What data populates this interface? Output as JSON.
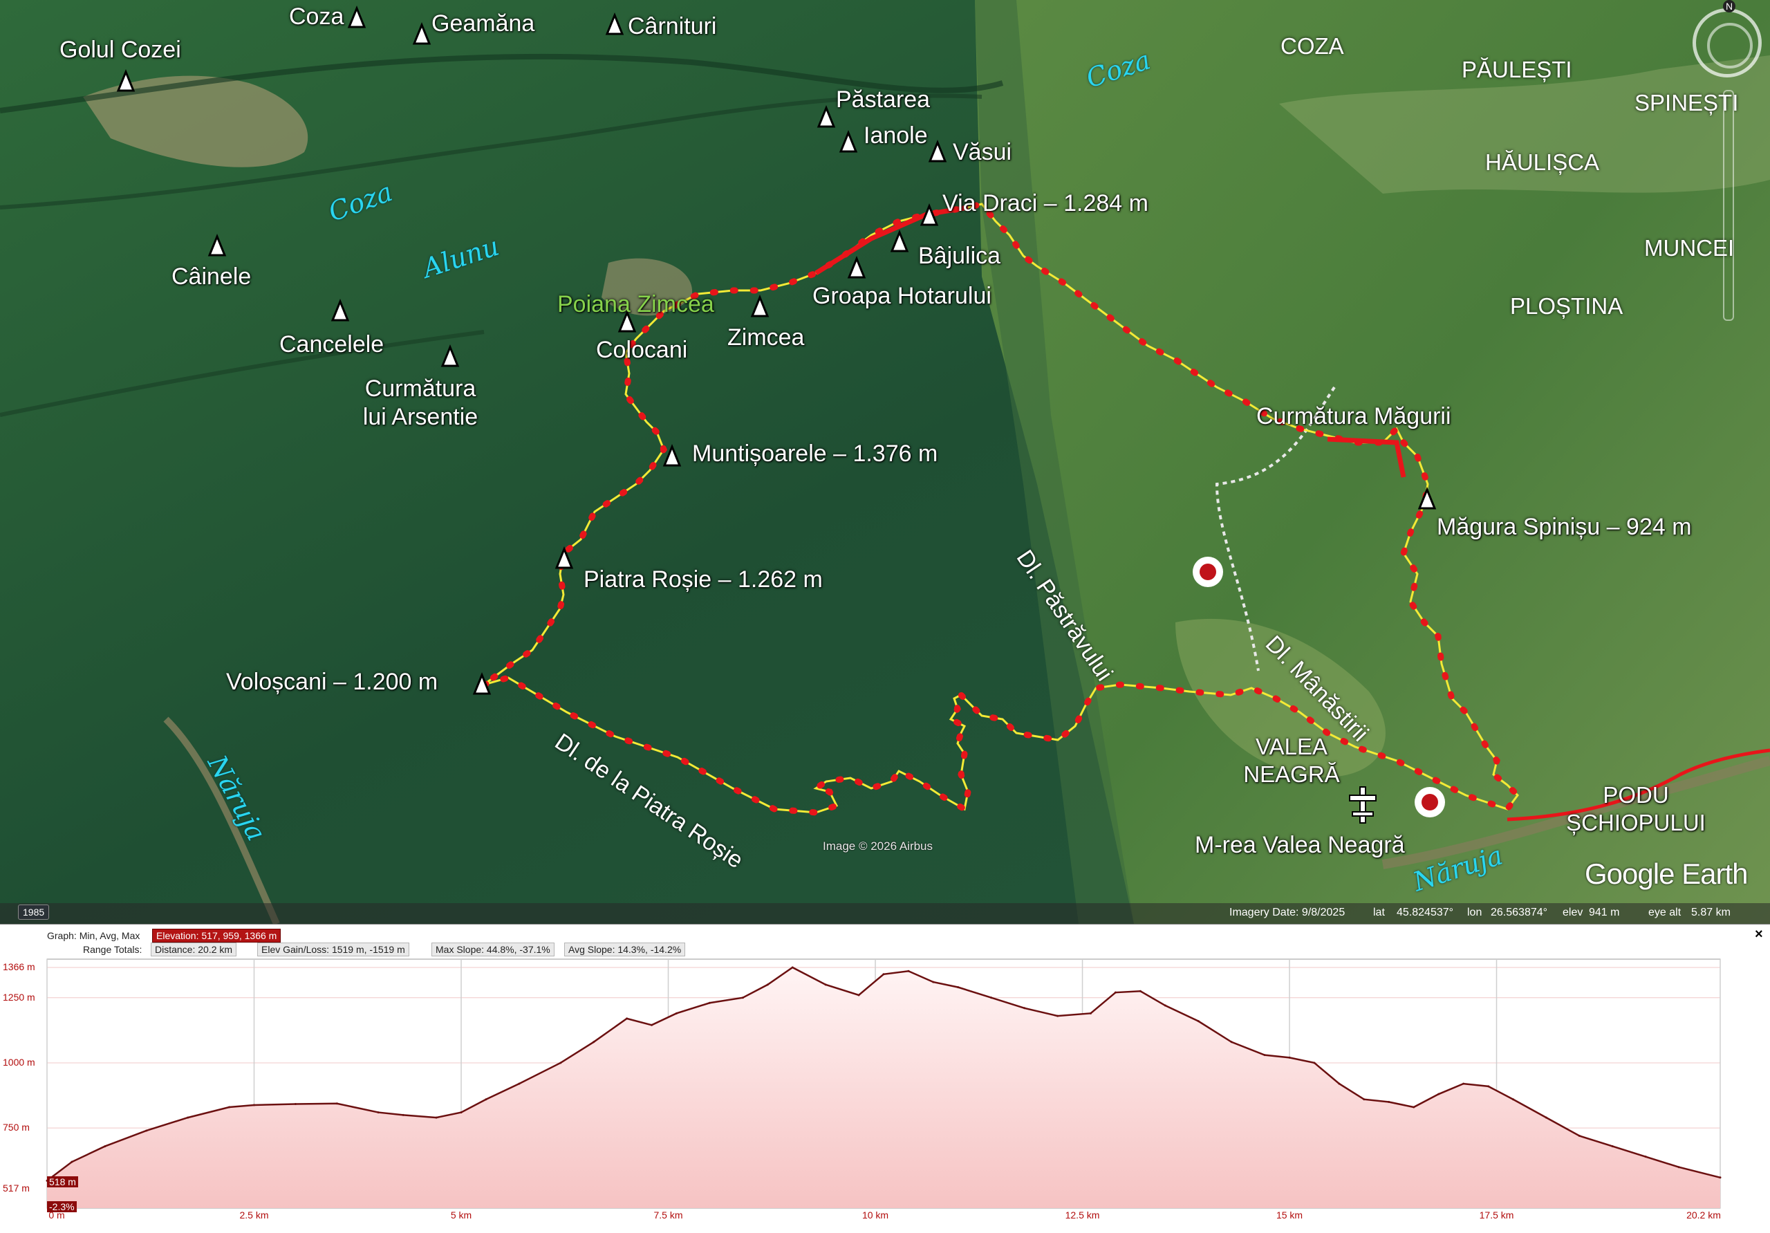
{
  "peaks": [
    {
      "name": "Coza",
      "label": "Coza"
    },
    {
      "name": "Geamana",
      "label": "Geamăna"
    },
    {
      "name": "Carnituri",
      "label": "Cârnituri"
    },
    {
      "name": "Golul-Cozei",
      "label": "Golul Cozei"
    },
    {
      "name": "Pastarea",
      "label": "Păstarea"
    },
    {
      "name": "Ianole",
      "label": "Ianole"
    },
    {
      "name": "Vasui",
      "label": "Văsui"
    },
    {
      "name": "Via-Draci",
      "label": "Via Draci – 1.284 m"
    },
    {
      "name": "Bajulica",
      "label": "Bâjulica"
    },
    {
      "name": "Groapa-Hotarului",
      "label": "Groapa Hotarului"
    },
    {
      "name": "Zimcea",
      "label": "Zimcea"
    },
    {
      "name": "Colocani",
      "label": "Colocani"
    },
    {
      "name": "Cainele",
      "label": "Câinele"
    },
    {
      "name": "Cancelele",
      "label": "Cancelele"
    },
    {
      "name": "Curmatura-lui-Arsentie",
      "label": "Curmătura\nlui Arsentie"
    },
    {
      "name": "Muntisoarele",
      "label": "Muntișoarele – 1.376 m"
    },
    {
      "name": "Piatra-Rosie",
      "label": "Piatra Roșie – 1.262 m"
    },
    {
      "name": "Voloscani",
      "label": "Voloșcani – 1.200 m"
    },
    {
      "name": "Magura-Spinisu",
      "label": "Măgura Spinișu – 924 m"
    }
  ],
  "places": {
    "poiana_zimcea": "Poiana Zimcea",
    "curmatura_magurii": "Curmătura Măgurii",
    "valea_neagra": "VALEA\nNEAGRĂ",
    "manastire": "M-rea Valea Neagră",
    "podu_schiopului": "PODU\nȘCHIOPULUI"
  },
  "villages": [
    "COZA",
    "PĂULEȘTI",
    "SPINEȘTI",
    "HĂULIȘCA",
    "MUNCEI",
    "PLOȘTINA"
  ],
  "rivers": {
    "coza_east": "Coza",
    "coza_west": "Coza",
    "alunu": "Alunu",
    "naruja_west": "Năruja",
    "naruja_east": "Năruja"
  },
  "ridges": {
    "dl_pastravului": "Dl. Păstrăvului",
    "dl_manastirii": "Dl. Mânăstirii",
    "dl_piatra_rosie": "Dl. de la Piatra Roșie"
  },
  "attribution": {
    "image": "Image © 2026 Airbus",
    "google_earth": "Google Earth",
    "year": "1985"
  },
  "status": {
    "imagery_date": "Imagery Date: 9/8/2025",
    "lat_label": "lat",
    "lat": "45.824537°",
    "lon_label": "lon",
    "lon": "26.563874°",
    "elev_label": "elev",
    "elev": "941 m",
    "eye_label": "eye alt",
    "eye": "5.87 km"
  },
  "colors": {
    "track": "#e8151a",
    "track_yellow": "#f3ea36",
    "river": "#29d6f0",
    "profile_fill_top": "#f6c3c3",
    "profile_line": "#6b1010"
  },
  "profile": {
    "graph_label": "Graph: Min, Avg, Max",
    "elevation": "Elevation: 517, 959, 1366 m",
    "range_label": "Range Totals:",
    "distance": "Distance: 20.2 km",
    "gain_loss": "Elev Gain/Loss: 1519 m, -1519 m",
    "max_slope": "Max Slope: 44.8%, -37.1%",
    "avg_slope": "Avg Slope: 14.3%, -14.2%",
    "close": "×",
    "tag_518": "518 m",
    "tag_slope": "-2.3%"
  },
  "chart_data": {
    "type": "area",
    "title": "",
    "xlabel": "",
    "ylabel": "",
    "x_unit": "km",
    "y_unit": "m",
    "xlim": [
      0,
      20.2
    ],
    "ylim": [
      517,
      1366
    ],
    "y_ticks": [
      "517 m",
      "750 m",
      "1000 m",
      "1250 m",
      "1366 m"
    ],
    "x_ticks": [
      "0 m",
      "2.5 km",
      "5 km",
      "7.5 km",
      "10 km",
      "12.5 km",
      "15 km",
      "17.5 km",
      "20.2 km"
    ],
    "series": [
      {
        "x": [
          0,
          0.3,
          0.7,
          1.2,
          1.7,
          2.2,
          2.5,
          3.0,
          3.5,
          4.0,
          4.3,
          4.7,
          5.0,
          5.3,
          5.7,
          6.2,
          6.6,
          7.0,
          7.3,
          7.6,
          8.0,
          8.4,
          8.7,
          9.0,
          9.4,
          9.8,
          10.1,
          10.4,
          10.7,
          11.0,
          11.4,
          11.8,
          12.2,
          12.6,
          12.9,
          13.2,
          13.5,
          13.9,
          14.3,
          14.7,
          15.0,
          15.3,
          15.6,
          15.9,
          16.2,
          16.5,
          16.8,
          17.1,
          17.4,
          17.7,
          18.1,
          18.5,
          18.9,
          19.3,
          19.7,
          20.2
        ],
        "y": [
          548,
          620,
          680,
          740,
          790,
          830,
          838,
          842,
          844,
          810,
          800,
          790,
          810,
          860,
          920,
          1000,
          1080,
          1170,
          1145,
          1190,
          1230,
          1250,
          1300,
          1366,
          1300,
          1260,
          1340,
          1352,
          1310,
          1290,
          1250,
          1210,
          1180,
          1190,
          1270,
          1275,
          1220,
          1160,
          1080,
          1030,
          1020,
          1000,
          920,
          860,
          850,
          830,
          880,
          920,
          910,
          860,
          790,
          720,
          680,
          640,
          600,
          560
        ]
      }
    ]
  }
}
